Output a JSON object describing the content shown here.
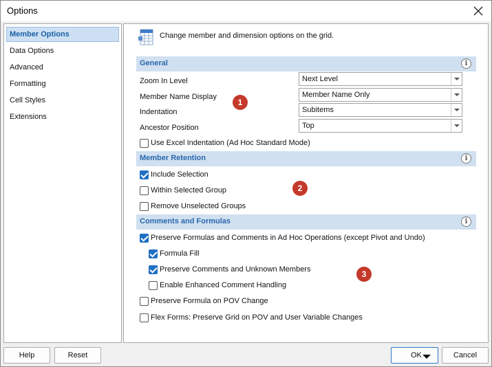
{
  "window": {
    "title": "Options"
  },
  "sidebar": {
    "items": [
      {
        "label": "Member Options",
        "selected": true
      },
      {
        "label": "Data Options"
      },
      {
        "label": "Advanced"
      },
      {
        "label": "Formatting"
      },
      {
        "label": "Cell Styles"
      },
      {
        "label": "Extensions"
      }
    ]
  },
  "header": {
    "text": "Change member and dimension options on the grid.",
    "icon": "grid-options-icon"
  },
  "general": {
    "title": "General",
    "zoom_label": "Zoom In Level",
    "zoom_value": "Next Level",
    "name_display_label": "Member Name Display",
    "name_display_value": "Member Name Only",
    "indentation_label": "Indentation",
    "indentation_value": "Subitems",
    "ancestor_label": "Ancestor Position",
    "ancestor_value": "Top",
    "excel_indent_label": "Use Excel Indentation (Ad Hoc Standard Mode)",
    "excel_indent_checked": false
  },
  "retention": {
    "title": "Member Retention",
    "include_label": "Include Selection",
    "include_checked": true,
    "within_label": "Within Selected Group",
    "within_checked": false,
    "remove_label": "Remove Unselected Groups",
    "remove_checked": false
  },
  "comments": {
    "title": "Comments and Formulas",
    "preserve_label": "Preserve Formulas and Comments in Ad Hoc Operations (except Pivot and Undo)",
    "preserve_checked": true,
    "fill_label": "Formula Fill",
    "fill_checked": true,
    "unknown_label": "Preserve Comments and Unknown Members",
    "unknown_checked": true,
    "enhanced_label": "Enable Enhanced Comment Handling",
    "enhanced_checked": false,
    "pov_label": "Preserve Formula on POV Change",
    "pov_checked": false,
    "flex_label": "Flex Forms: Preserve Grid on POV and User Variable Changes",
    "flex_checked": false
  },
  "info_glyph": "i",
  "badges": [
    "1",
    "2",
    "3"
  ],
  "buttons": {
    "help": "Help",
    "reset": "Reset",
    "ok": "OK",
    "cancel": "Cancel"
  },
  "colors": {
    "accent": "#1f6fc4",
    "section_bg": "#d0e0f0",
    "section_text": "#2a68ad",
    "badge": "#c4392b"
  }
}
